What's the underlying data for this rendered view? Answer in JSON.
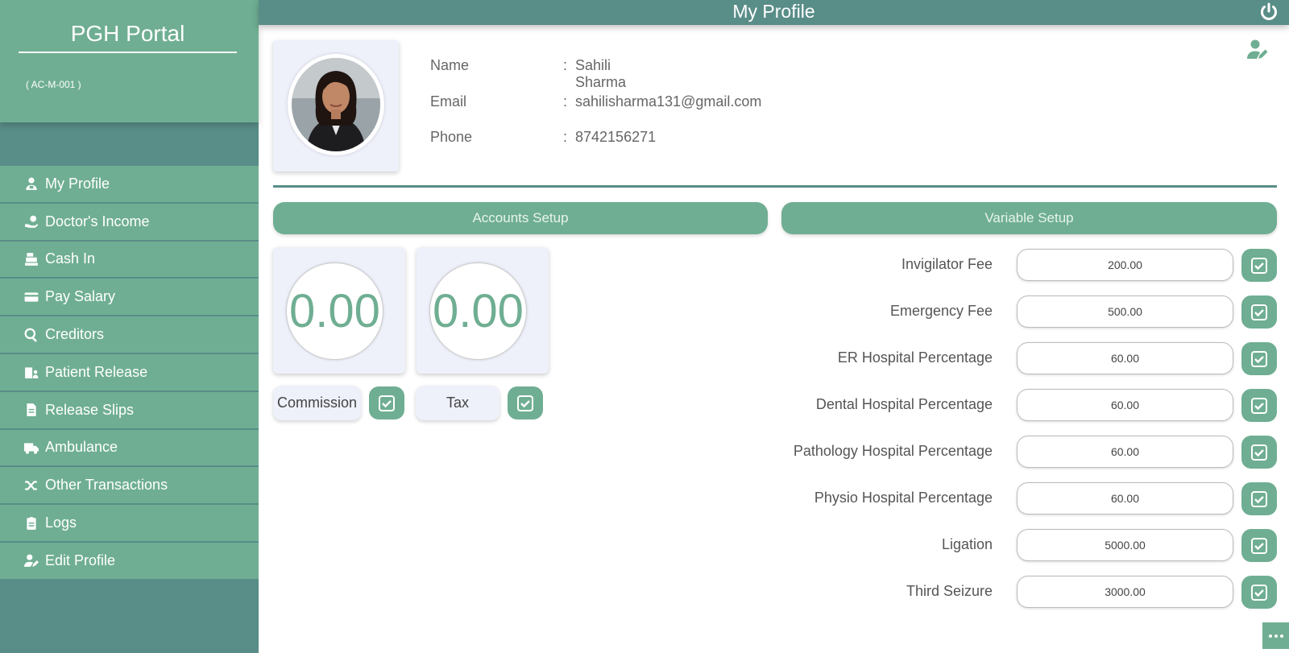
{
  "app": {
    "brand_title": "PGH Portal",
    "brand_code": "( AC-M-001 )",
    "page_title": "My Profile"
  },
  "colors": {
    "primary": "#6fae92",
    "primary_dark": "#598d88",
    "card_bg": "#eef0fa"
  },
  "sidebar": {
    "items": [
      {
        "label": "My Profile",
        "icon": "user-nurse-icon"
      },
      {
        "label": "Doctor's Income",
        "icon": "hand-holding-dollar-icon"
      },
      {
        "label": "Cash In",
        "icon": "cash-register-icon"
      },
      {
        "label": "Pay Salary",
        "icon": "credit-card-icon"
      },
      {
        "label": "Creditors",
        "icon": "search-dollar-icon"
      },
      {
        "label": "Patient Release",
        "icon": "hospital-user-icon"
      },
      {
        "label": "Release Slips",
        "icon": "file-invoice-icon"
      },
      {
        "label": "Ambulance",
        "icon": "ambulance-icon"
      },
      {
        "label": "Other Transactions",
        "icon": "random-icon"
      },
      {
        "label": "Logs",
        "icon": "clipboard-list-icon"
      },
      {
        "label": "Edit Profile",
        "icon": "user-edit-icon"
      }
    ]
  },
  "profile": {
    "name_label": "Name",
    "name_value": "Sahili Sharma",
    "email_label": "Email",
    "email_value": "sahilisharma131@gmail.com",
    "phone_label": "Phone",
    "phone_value": "8742156271",
    "colon": ":"
  },
  "accounts_setup": {
    "title": "Accounts Setup",
    "commission_value": "0.00",
    "tax_value": "0.00",
    "commission_label": "Commission",
    "tax_label": "Tax"
  },
  "variable_setup": {
    "title": "Variable Setup",
    "rows": [
      {
        "label": "Invigilator Fee",
        "value": "200.00"
      },
      {
        "label": "Emergency Fee",
        "value": "500.00"
      },
      {
        "label": "ER Hospital Percentage",
        "value": "60.00"
      },
      {
        "label": "Dental Hospital Percentage",
        "value": "60.00"
      },
      {
        "label": "Pathology Hospital Percentage",
        "value": "60.00"
      },
      {
        "label": "Physio Hospital Percentage",
        "value": "60.00"
      },
      {
        "label": "Ligation",
        "value": "5000.00"
      },
      {
        "label": "Third Seizure",
        "value": "3000.00"
      }
    ]
  }
}
